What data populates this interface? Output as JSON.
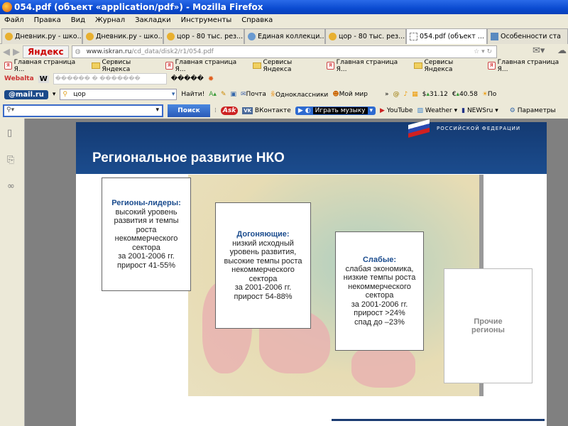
{
  "window": {
    "title": "054.pdf (объект «application/pdf») - Mozilla Firefox"
  },
  "menu": [
    "Файл",
    "Правка",
    "Вид",
    "Журнал",
    "Закладки",
    "Инструменты",
    "Справка"
  ],
  "tabs": [
    {
      "label": "Дневник.ру - шко..."
    },
    {
      "label": "Дневник.ру - шко..."
    },
    {
      "label": "цор - 80 тыс. рез..."
    },
    {
      "label": "Единая коллекци..."
    },
    {
      "label": "цор - 80 тыс. рез..."
    },
    {
      "label": "054.pdf (объект ..."
    },
    {
      "label": "Особенности ста"
    }
  ],
  "nav": {
    "yandex": "Яндекс",
    "url_host": "www.iskran.ru",
    "url_path": "/cd_data/disk2/r1/054.pdf"
  },
  "bookmarks": [
    "Главная страница Я...",
    "Сервисы Яндекса",
    "Главная страница Я...",
    "Сервисы Яндекса",
    "Главная страница Я...",
    "Сервисы Яндекса",
    "Главная страница Я..."
  ],
  "webalta": {
    "logo": "Webalta",
    "field": "������ � �������",
    "label": "�����"
  },
  "mailbar": {
    "logo": "@mail.ru",
    "query": "цор",
    "find": "Найти!",
    "pochta": "Почта",
    "ok": "Одноклассники",
    "moimir": "Мой мир",
    "usd": "31.12",
    "eur": "40.58",
    "weather": "По"
  },
  "searchbar": {
    "button": "Поиск",
    "ask": "Ask",
    "vk": "ВКонтакте",
    "music": "Играть музыку",
    "youtube": "YouTube",
    "weather": "Weather",
    "news": "NEWSru",
    "params": "Параметры"
  },
  "slide": {
    "title": "Региональное развитие НКО",
    "org": "РОССИЙСКОЙ ФЕДЕРАЦИИ",
    "boxes": [
      {
        "head": "Регионы-лидеры:",
        "lines": [
          "высокий уровень",
          "развития и темпы",
          "роста",
          "некоммерческого",
          "сектора",
          "за 2001-2006 гг.",
          "прирост 41-55%"
        ]
      },
      {
        "head": "Догоняющие:",
        "lines": [
          "низкий исходный",
          "уровень развития,",
          "высокие темпы роста",
          "некоммерческого",
          "сектора",
          "за 2001-2006 гг.",
          "прирост 54-88%"
        ]
      },
      {
        "head": "Слабые:",
        "lines": [
          "слабая экономика,",
          "низкие темпы роста",
          "некоммерческого",
          "сектора",
          "за 2001-2006 гг.",
          "прирост >24%",
          "спад до –23%"
        ]
      },
      {
        "head": "",
        "lines": [
          "Прочие",
          "регионы"
        ]
      }
    ]
  }
}
